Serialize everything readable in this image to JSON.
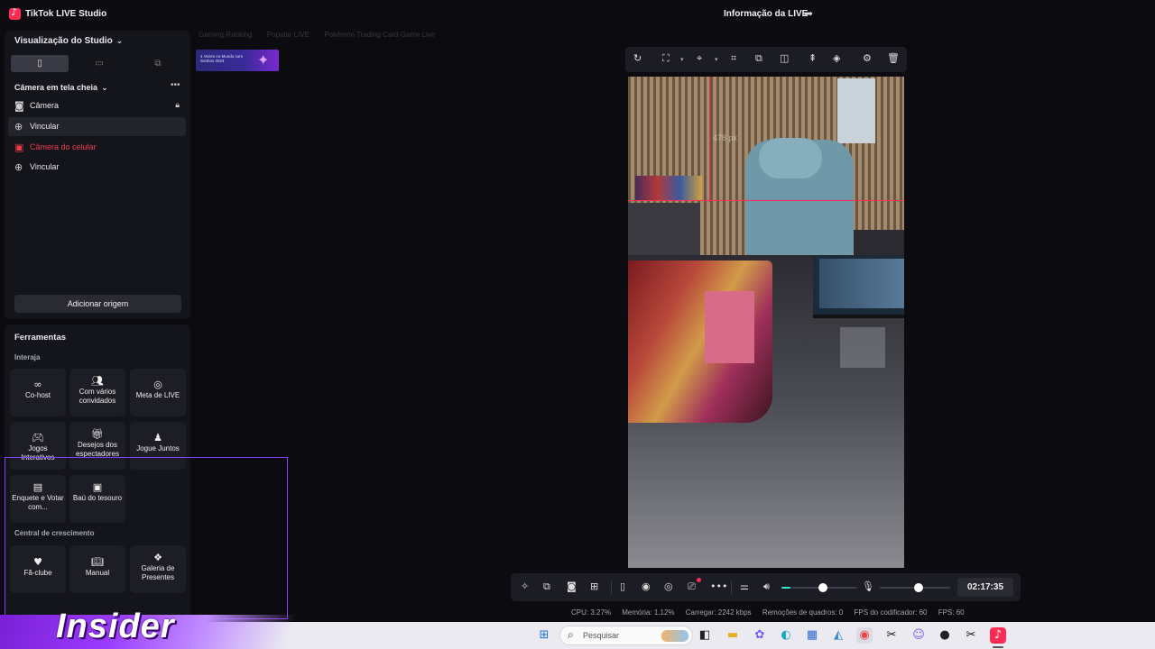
{
  "app": {
    "title": "TikTok LIVE Studio",
    "live_info": "Informação da LIVE"
  },
  "studio": {
    "title": "Visualização do Studio",
    "scene_title": "Câmera em tela cheia",
    "sources": [
      {
        "label": "Câmera",
        "icon": "camera-icon",
        "locked": true,
        "state": "normal"
      },
      {
        "label": "Vincular",
        "icon": "globe-icon",
        "state": "selected"
      },
      {
        "label": "Câmera do celular",
        "icon": "phone-camera-icon",
        "state": "error"
      },
      {
        "label": "Vincular",
        "icon": "globe-icon",
        "state": "normal"
      }
    ],
    "add_source_label": "Adicionar origem"
  },
  "tools": {
    "title": "Ferramentas",
    "section_interact": "Interaja",
    "interact_items": [
      {
        "label": "Co-host",
        "icon": "link-icon"
      },
      {
        "label": "Com vários convidados",
        "icon": "users-icon"
      },
      {
        "label": "Meta de LIVE",
        "icon": "target-icon"
      },
      {
        "label": "Jogos Interativos",
        "icon": "gamepad-icon"
      },
      {
        "label": "Desejos dos espectadores",
        "icon": "gift-icon"
      },
      {
        "label": "Jogue Juntos",
        "icon": "joystick-icon"
      },
      {
        "label": "Enquete e Votar com...",
        "icon": "poll-icon"
      },
      {
        "label": "Baú do tesouro",
        "icon": "chest-icon"
      }
    ],
    "section_growth": "Central de crescimento",
    "growth_items": [
      {
        "label": "Fã-clube",
        "icon": "heart-icon"
      },
      {
        "label": "Manual",
        "icon": "book-icon"
      },
      {
        "label": "Galeria de Presentes",
        "icon": "gift-gallery-icon"
      }
    ]
  },
  "recommendations": [
    "Gaming Ranking",
    "Popular LIVE",
    "Pokémon Trading Card Game Live"
  ],
  "thumbnail_text": "4 Vezes no Mundo com Sonhos 2024",
  "preview": {
    "guide_label": "478 px"
  },
  "controls": {
    "timer": "02:17:35",
    "volume_level": 0.55,
    "mic_level": 0.55
  },
  "stats": {
    "cpu": "CPU: 3.27%",
    "memory": "Memória: 1.12%",
    "upload": "Carregar: 2242 kbps",
    "dropped": "Remoções de quadros: 0",
    "encoder_fps": "FPS do codificador: 60",
    "fps": "FPS: 60"
  },
  "taskbar": {
    "search_placeholder": "Pesquisar"
  },
  "overlay": {
    "logo_text": "Insider"
  },
  "colors": {
    "accent": "#fe2c55",
    "teal": "#2ee6c8",
    "error": "#ef3b4d",
    "purple": "#8a3cff"
  }
}
